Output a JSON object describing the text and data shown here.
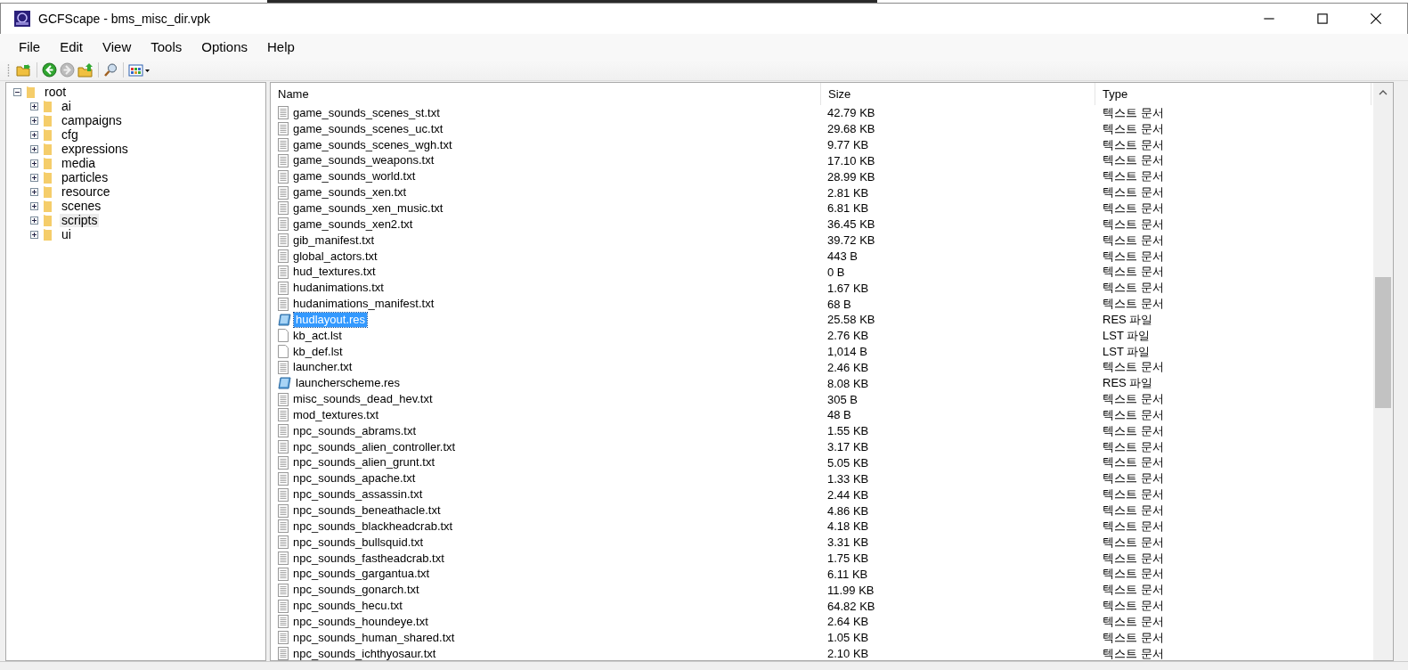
{
  "window": {
    "title": "GCFScape - bms_misc_dir.vpk"
  },
  "menu": [
    "File",
    "Edit",
    "View",
    "Tools",
    "Options",
    "Help"
  ],
  "tree": {
    "label": "root",
    "expanded": true,
    "selected": false,
    "children": [
      {
        "label": "ai",
        "expanded": false,
        "selected": false
      },
      {
        "label": "campaigns",
        "expanded": false,
        "selected": false
      },
      {
        "label": "cfg",
        "expanded": false,
        "selected": false
      },
      {
        "label": "expressions",
        "expanded": false,
        "selected": false
      },
      {
        "label": "media",
        "expanded": false,
        "selected": false
      },
      {
        "label": "particles",
        "expanded": false,
        "selected": false
      },
      {
        "label": "resource",
        "expanded": false,
        "selected": false
      },
      {
        "label": "scenes",
        "expanded": false,
        "selected": false
      },
      {
        "label": "scripts",
        "expanded": false,
        "selected": true
      },
      {
        "label": "ui",
        "expanded": false,
        "selected": false
      }
    ]
  },
  "table": {
    "columns": [
      "Name",
      "Size",
      "Type"
    ],
    "rows": [
      {
        "kind": "text",
        "name": "game_sounds_scenes_st.txt",
        "size": "42.79 KB",
        "type": "텍스트 문서",
        "selected": false
      },
      {
        "kind": "text",
        "name": "game_sounds_scenes_uc.txt",
        "size": "29.68 KB",
        "type": "텍스트 문서",
        "selected": false
      },
      {
        "kind": "text",
        "name": "game_sounds_scenes_wgh.txt",
        "size": "9.77 KB",
        "type": "텍스트 문서",
        "selected": false
      },
      {
        "kind": "text",
        "name": "game_sounds_weapons.txt",
        "size": "17.10 KB",
        "type": "텍스트 문서",
        "selected": false
      },
      {
        "kind": "text",
        "name": "game_sounds_world.txt",
        "size": "28.99 KB",
        "type": "텍스트 문서",
        "selected": false
      },
      {
        "kind": "text",
        "name": "game_sounds_xen.txt",
        "size": "2.81 KB",
        "type": "텍스트 문서",
        "selected": false
      },
      {
        "kind": "text",
        "name": "game_sounds_xen_music.txt",
        "size": "6.81 KB",
        "type": "텍스트 문서",
        "selected": false
      },
      {
        "kind": "text",
        "name": "game_sounds_xen2.txt",
        "size": "36.45 KB",
        "type": "텍스트 문서",
        "selected": false
      },
      {
        "kind": "text",
        "name": "gib_manifest.txt",
        "size": "39.72 KB",
        "type": "텍스트 문서",
        "selected": false
      },
      {
        "kind": "text",
        "name": "global_actors.txt",
        "size": "443 B",
        "type": "텍스트 문서",
        "selected": false
      },
      {
        "kind": "text",
        "name": "hud_textures.txt",
        "size": "0 B",
        "type": "텍스트 문서",
        "selected": false
      },
      {
        "kind": "text",
        "name": "hudanimations.txt",
        "size": "1.67 KB",
        "type": "텍스트 문서",
        "selected": false
      },
      {
        "kind": "text",
        "name": "hudanimations_manifest.txt",
        "size": "68 B",
        "type": "텍스트 문서",
        "selected": false
      },
      {
        "kind": "res",
        "name": "hudlayout.res",
        "size": "25.58 KB",
        "type": "RES 파일",
        "selected": true
      },
      {
        "kind": "blank",
        "name": "kb_act.lst",
        "size": "2.76 KB",
        "type": "LST 파일",
        "selected": false
      },
      {
        "kind": "blank",
        "name": "kb_def.lst",
        "size": "1,014 B",
        "type": "LST 파일",
        "selected": false
      },
      {
        "kind": "text",
        "name": "launcher.txt",
        "size": "2.46 KB",
        "type": "텍스트 문서",
        "selected": false
      },
      {
        "kind": "res",
        "name": "launcherscheme.res",
        "size": "8.08 KB",
        "type": "RES 파일",
        "selected": false
      },
      {
        "kind": "text",
        "name": "misc_sounds_dead_hev.txt",
        "size": "305 B",
        "type": "텍스트 문서",
        "selected": false
      },
      {
        "kind": "text",
        "name": "mod_textures.txt",
        "size": "48 B",
        "type": "텍스트 문서",
        "selected": false
      },
      {
        "kind": "text",
        "name": "npc_sounds_abrams.txt",
        "size": "1.55 KB",
        "type": "텍스트 문서",
        "selected": false
      },
      {
        "kind": "text",
        "name": "npc_sounds_alien_controller.txt",
        "size": "3.17 KB",
        "type": "텍스트 문서",
        "selected": false
      },
      {
        "kind": "text",
        "name": "npc_sounds_alien_grunt.txt",
        "size": "5.05 KB",
        "type": "텍스트 문서",
        "selected": false
      },
      {
        "kind": "text",
        "name": "npc_sounds_apache.txt",
        "size": "1.33 KB",
        "type": "텍스트 문서",
        "selected": false
      },
      {
        "kind": "text",
        "name": "npc_sounds_assassin.txt",
        "size": "2.44 KB",
        "type": "텍스트 문서",
        "selected": false
      },
      {
        "kind": "text",
        "name": "npc_sounds_beneathacle.txt",
        "size": "4.86 KB",
        "type": "텍스트 문서",
        "selected": false
      },
      {
        "kind": "text",
        "name": "npc_sounds_blackheadcrab.txt",
        "size": "4.18 KB",
        "type": "텍스트 문서",
        "selected": false
      },
      {
        "kind": "text",
        "name": "npc_sounds_bullsquid.txt",
        "size": "3.31 KB",
        "type": "텍스트 문서",
        "selected": false
      },
      {
        "kind": "text",
        "name": "npc_sounds_fastheadcrab.txt",
        "size": "1.75 KB",
        "type": "텍스트 문서",
        "selected": false
      },
      {
        "kind": "text",
        "name": "npc_sounds_gargantua.txt",
        "size": "6.11 KB",
        "type": "텍스트 문서",
        "selected": false
      },
      {
        "kind": "text",
        "name": "npc_sounds_gonarch.txt",
        "size": "11.99 KB",
        "type": "텍스트 문서",
        "selected": false
      },
      {
        "kind": "text",
        "name": "npc_sounds_hecu.txt",
        "size": "64.82 KB",
        "type": "텍스트 문서",
        "selected": false
      },
      {
        "kind": "text",
        "name": "npc_sounds_houndeye.txt",
        "size": "2.64 KB",
        "type": "텍스트 문서",
        "selected": false
      },
      {
        "kind": "text",
        "name": "npc_sounds_human_shared.txt",
        "size": "1.05 KB",
        "type": "텍스트 문서",
        "selected": false
      },
      {
        "kind": "text",
        "name": "npc_sounds_ichthyosaur.txt",
        "size": "2.10 KB",
        "type": "텍스트 문서",
        "selected": false
      }
    ]
  }
}
